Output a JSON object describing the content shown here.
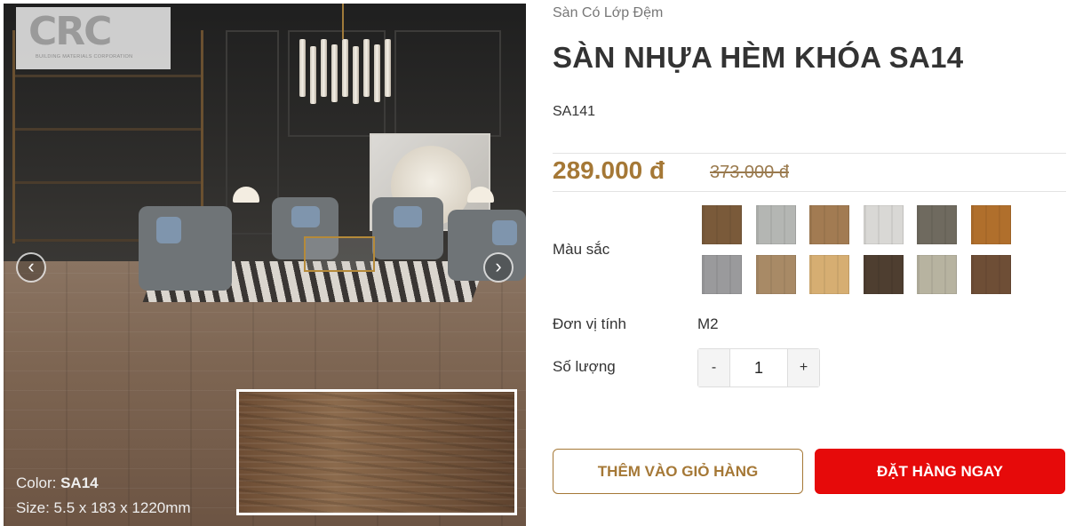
{
  "gallery": {
    "logo_text": "CRC",
    "logo_subtitle": "BUILDING MATERIALS CORPORATION",
    "prev_icon": "chevron-left-icon",
    "next_icon": "chevron-right-icon",
    "caption_color_label": "Color:",
    "caption_color_value": "SA14",
    "caption_size": "Size: 5.5 x 183 x 1220mm"
  },
  "product": {
    "category": "Sàn Có Lớp Đệm",
    "title": "SÀN NHỰA HÈM KHÓA SA14",
    "sku": "SA141",
    "price": "289.000 đ",
    "old_price": "373.000 đ",
    "color_label": "Màu sắc",
    "swatches": [
      {
        "color": "#7a5a3a"
      },
      {
        "color": "#b4b6b3"
      },
      {
        "color": "#a27b52"
      },
      {
        "color": "#d9d8d5"
      },
      {
        "color": "#6f6a5f"
      },
      {
        "color": "#b06f2c"
      },
      {
        "color": "#9a9a9c"
      },
      {
        "color": "#a88a66"
      },
      {
        "color": "#d6ae72"
      },
      {
        "color": "#4e3e30"
      },
      {
        "color": "#b7b3a0"
      },
      {
        "color": "#6e4e36"
      }
    ],
    "unit_label": "Đơn vị tính",
    "unit_value": "M2",
    "quantity_label": "Số lượng",
    "quantity_minus": "-",
    "quantity_value": "1",
    "quantity_plus": "+",
    "add_to_cart": "THÊM VÀO GIỎ HÀNG",
    "order_now": "ĐẶT HÀNG NGAY"
  }
}
